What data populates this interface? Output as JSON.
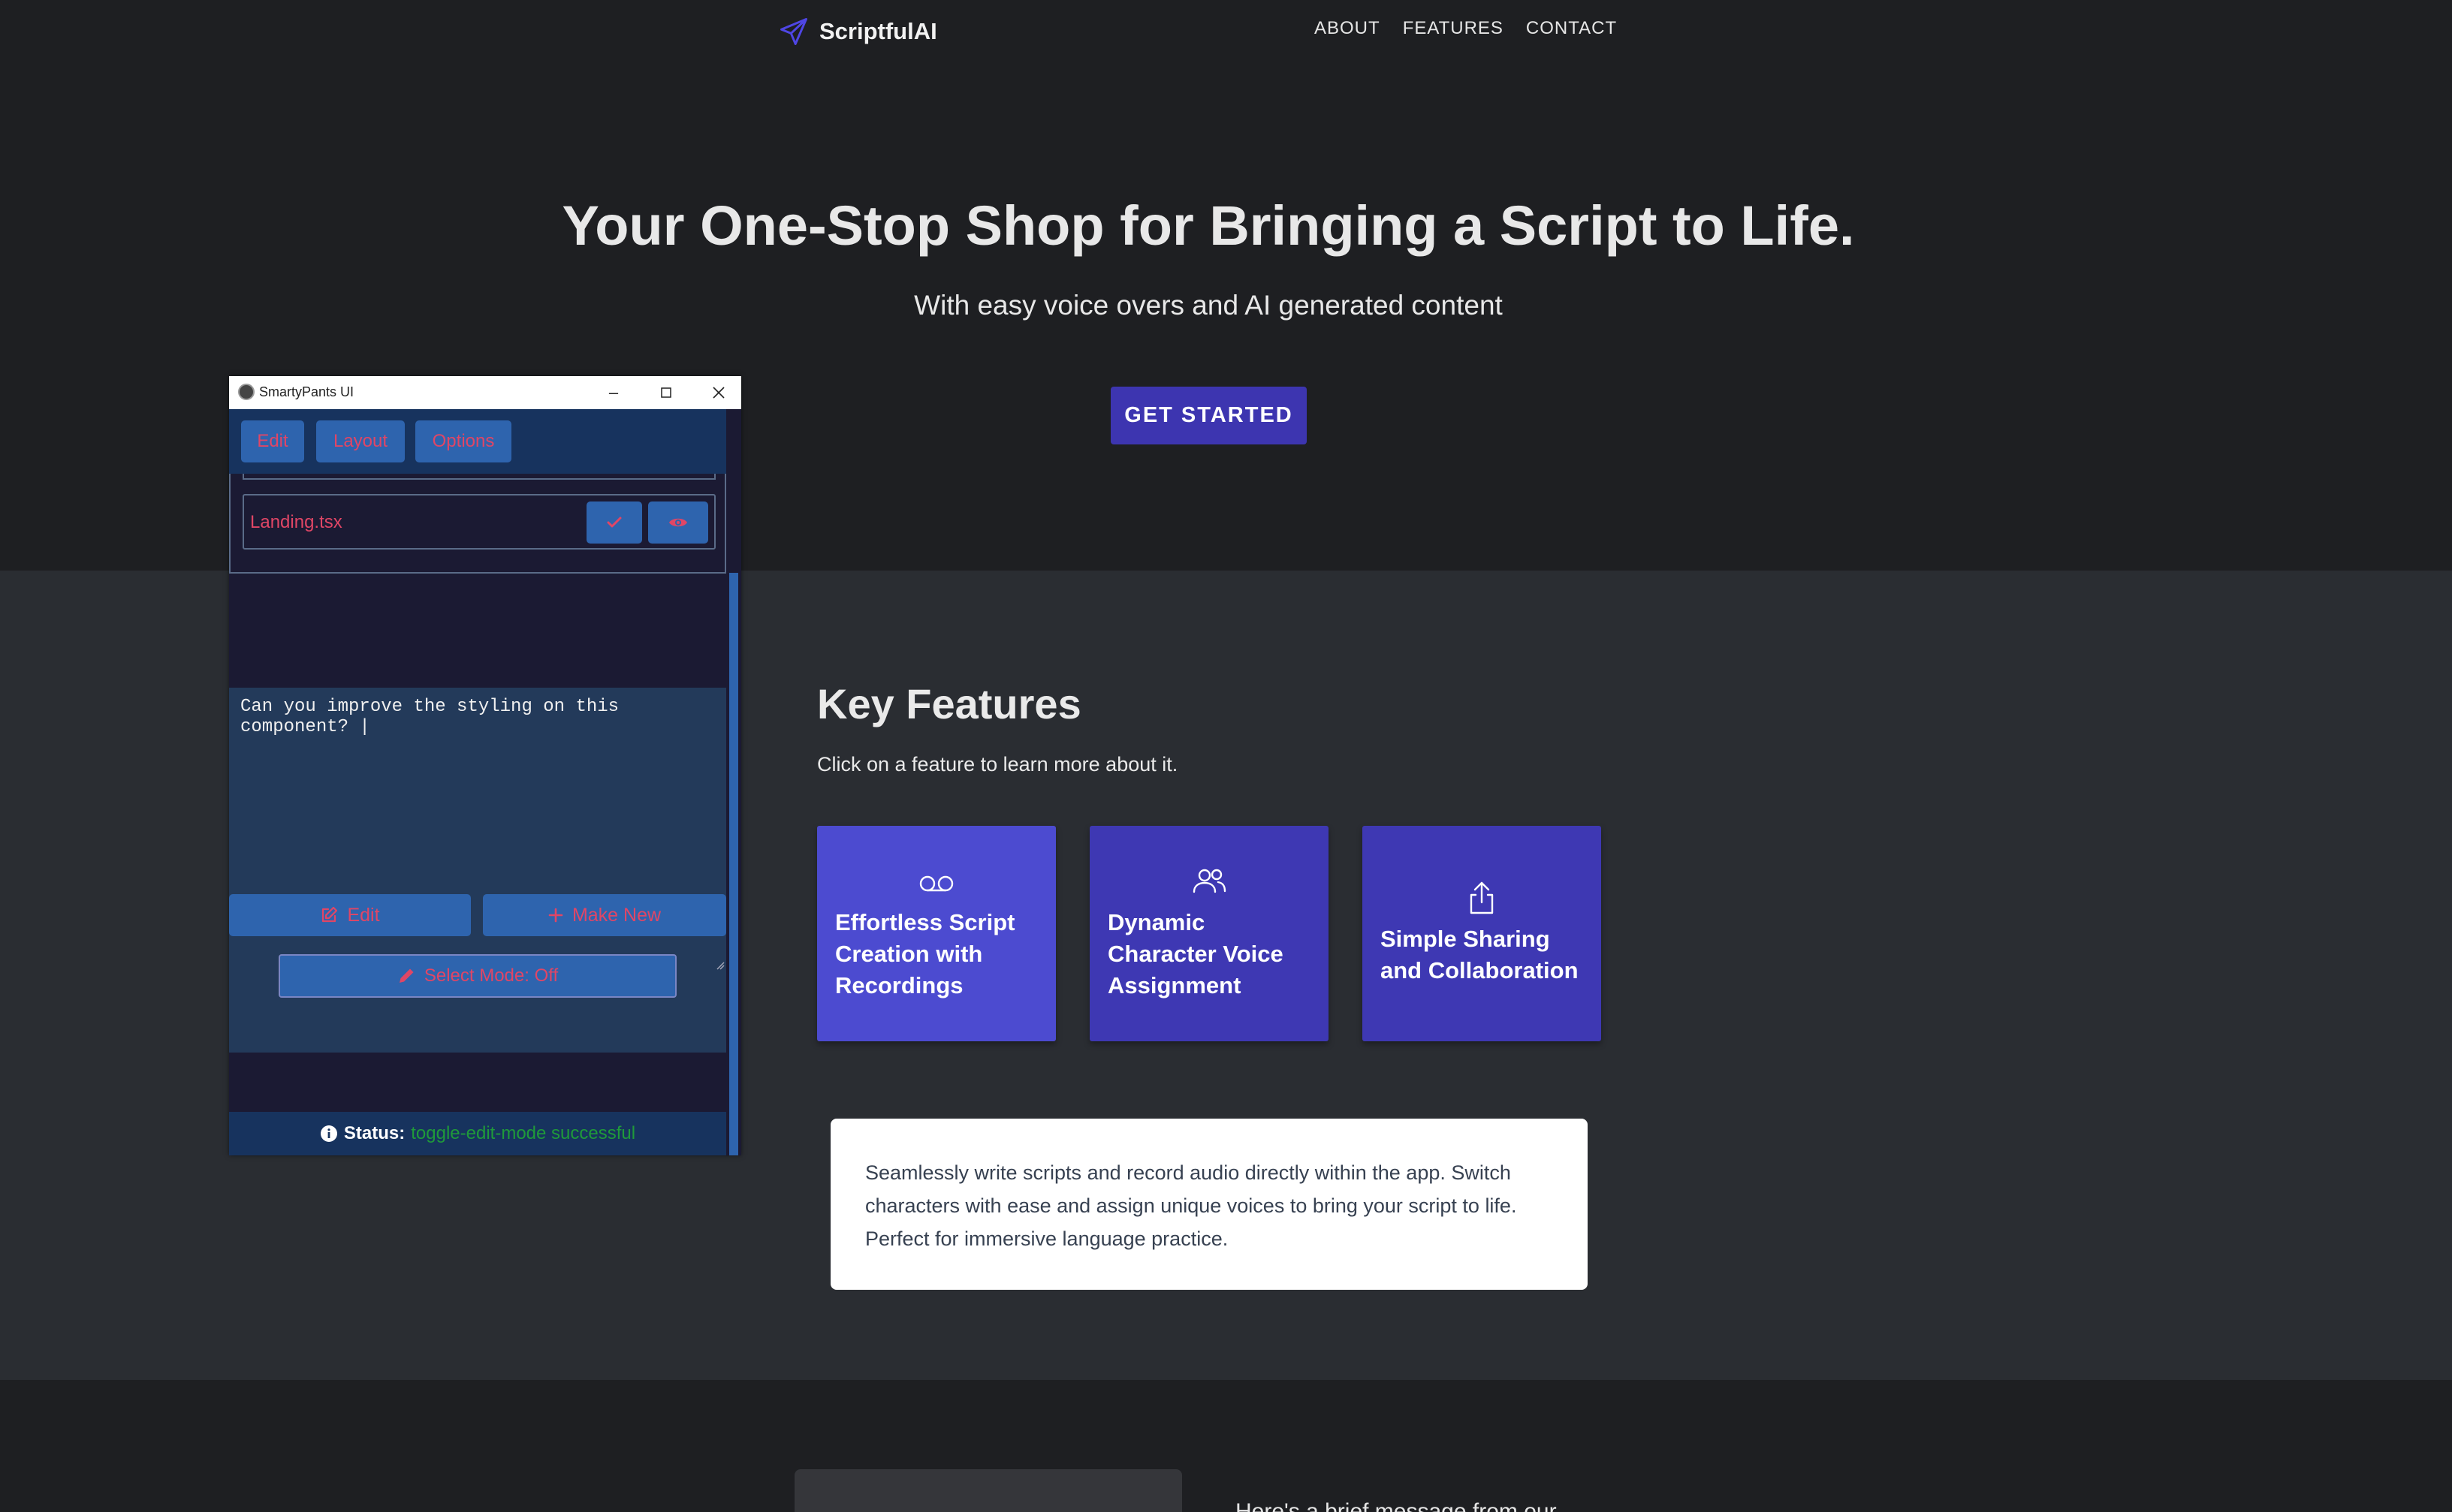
{
  "nav": {
    "brand": "ScriptfulAI",
    "links": [
      "ABOUT",
      "FEATURES",
      "CONTACT"
    ]
  },
  "hero": {
    "title": "Your One-Stop Shop for Bringing a Script to Life.",
    "subtitle": "With easy voice overs and AI generated content",
    "cta": "GET STARTED"
  },
  "features": {
    "title": "Key Features",
    "subtitle": "Click on a feature to learn more about it.",
    "cards": [
      {
        "label": "Effortless Script Creation with Recordings",
        "icon": "voicemail-icon"
      },
      {
        "label": "Dynamic Character Voice Assignment",
        "icon": "users-icon"
      },
      {
        "label": "Simple Sharing and Collaboration",
        "icon": "share-icon"
      }
    ],
    "description": "Seamlessly write scripts and record audio directly within the app. Switch characters with ease and assign unique voices to bring your script to life. Perfect for immersive language practice."
  },
  "bottom": {
    "text": "Here's a brief message from our"
  },
  "app": {
    "window_title": "SmartyPants UI",
    "menu": [
      "Edit",
      "Layout",
      "Options"
    ],
    "file_name": "Landing.tsx",
    "prompt": "Can you improve the styling on this\ncomponent? |",
    "edit_button": "Edit",
    "make_new_button": "Make New",
    "select_mode_button": "Select Mode: Off",
    "status_label": "Status:",
    "status_value": "toggle-edit-mode successful"
  },
  "colors": {
    "accent": "#3d35b0",
    "card_active": "#4c4bd0",
    "app_button": "#2e64ae",
    "app_text": "#e04666",
    "status_ok": "#1f9a3a"
  }
}
